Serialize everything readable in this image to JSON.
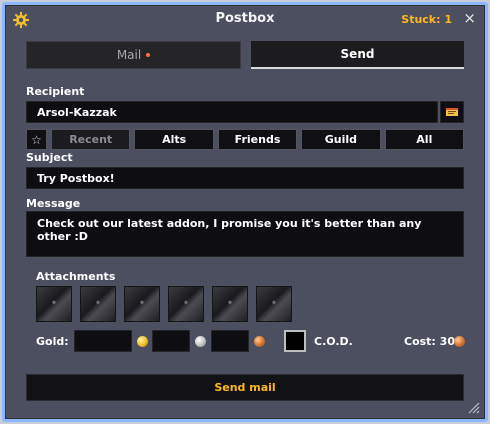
{
  "window": {
    "title": "Postbox",
    "stuck_label": "Stuck: 1",
    "close_glyph": "×",
    "settings_icon": "gear-icon"
  },
  "tabs": [
    {
      "label": "Mail",
      "active": false,
      "has_notification": true
    },
    {
      "label": "Send",
      "active": true
    }
  ],
  "recipient": {
    "label": "Recipient",
    "value": "Arsol-Kazzak",
    "address_book_icon": "address-book-icon"
  },
  "filters": {
    "favorite_icon": "star-icon",
    "items": [
      {
        "label": "Recent",
        "disabled": true
      },
      {
        "label": "Alts"
      },
      {
        "label": "Friends"
      },
      {
        "label": "Guild"
      },
      {
        "label": "All"
      }
    ]
  },
  "subject": {
    "label": "Subject",
    "value": "Try Postbox!"
  },
  "message": {
    "label": "Message",
    "value": "Check out our latest addon, I promise you it's better than any other :D"
  },
  "attachments": {
    "label": "Attachments",
    "slot_count": 6
  },
  "money": {
    "gold_label": "Gold:",
    "gold_value": "",
    "silver_value": "",
    "copper_value": "",
    "cod_label": "C.O.D.",
    "cod_checked": false,
    "cost_label": "Cost: 30"
  },
  "send_button": {
    "label": "Send mail"
  },
  "colors": {
    "accent": "#ffb81c",
    "frame": "#8eb6ff",
    "panel": "#4b4f60"
  }
}
